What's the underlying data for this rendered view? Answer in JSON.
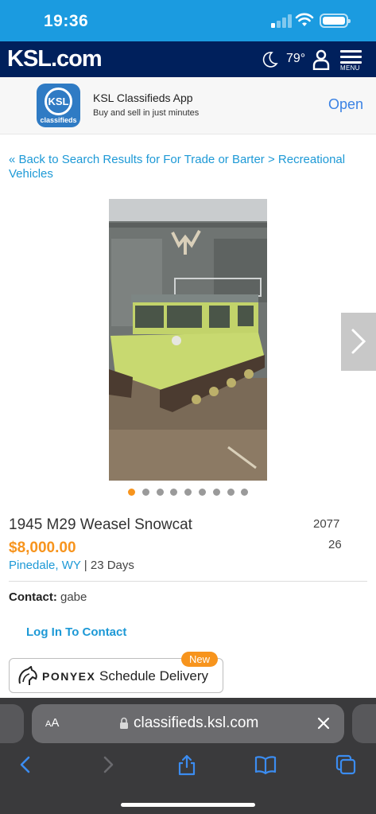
{
  "status_bar": {
    "time": "19:36"
  },
  "header": {
    "logo_main": "KSL",
    "logo_suffix": ".com",
    "temperature": "79°",
    "menu_label": "MENU"
  },
  "app_banner": {
    "icon_text": "KSL",
    "icon_subtext": "classifieds",
    "title": "KSL Classifieds App",
    "subtitle": "Buy and sell in just minutes",
    "open_label": "Open"
  },
  "breadcrumb": {
    "text": "« Back to Search Results for For Trade or Barter > Recreational Vehicles"
  },
  "carousel": {
    "total_images": 9,
    "active_index": 0
  },
  "listing": {
    "title": "1945 M29 Weasel Snowcat",
    "price": "$8,000.00",
    "location": "Pinedale, WY",
    "age": "| 23 Days",
    "views": "2077",
    "favorites": "26",
    "contact_label": "Contact:",
    "contact_name": "gabe",
    "login_link": "Log In To Contact"
  },
  "ponyex": {
    "brand": "PONYEX",
    "action": "Schedule Delivery",
    "badge": "New"
  },
  "safari": {
    "aa_small": "A",
    "aa_large": "A",
    "url": "classifieds.ksl.com"
  },
  "colors": {
    "status_bar": "#1b9be0",
    "header": "#00205c",
    "link": "#1d99d6",
    "price": "#f7941d",
    "safari_bar": "#3a3a3c"
  }
}
